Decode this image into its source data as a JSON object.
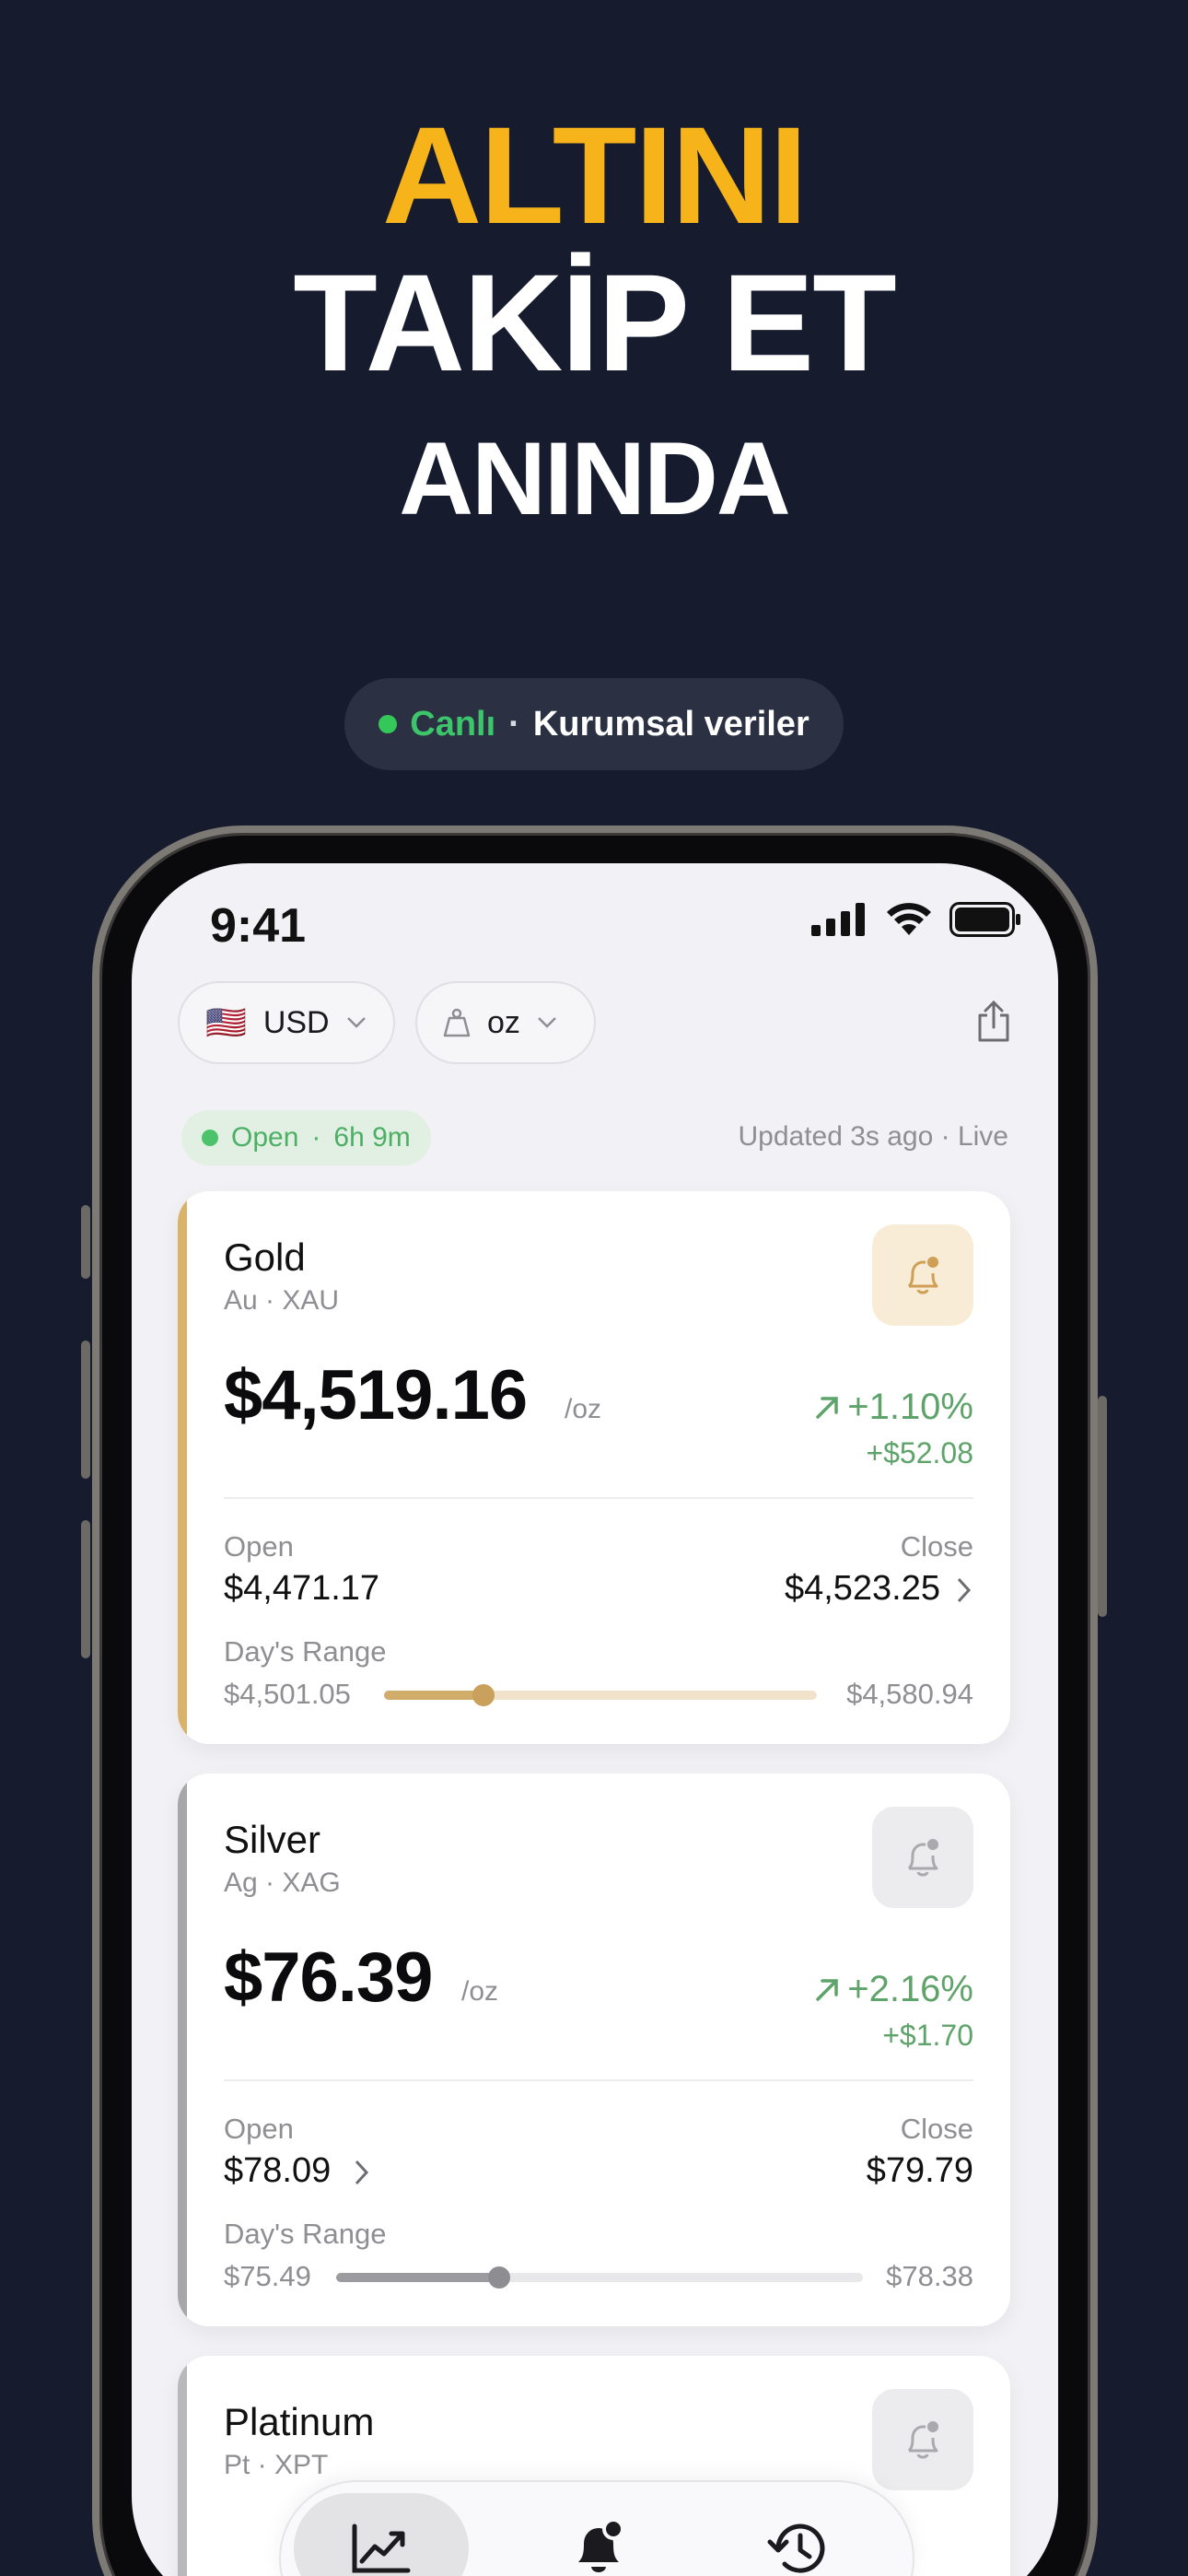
{
  "headline": {
    "line1": "ALTINI",
    "line2": "TAKİP ET",
    "line3": "ANINDA"
  },
  "badge": {
    "live_label": "Canlı",
    "separator": "·",
    "source_label": "Kurumsal veriler"
  },
  "status_bar": {
    "time": "9:41"
  },
  "toolbar": {
    "currency_flag": "🇺🇸",
    "currency_label": "USD",
    "unit_label": "oz",
    "share_icon": "share-icon"
  },
  "market": {
    "status_label": "Open",
    "status_sep": "·",
    "time_left": "6h 9m",
    "updated_text": "Updated 3s ago · Live"
  },
  "metals": [
    {
      "name": "Gold",
      "symbol": "Au · XAU",
      "price": "$4,519.16",
      "unit": "/oz",
      "change_pct": "+1.10%",
      "change_abs": "+$52.08",
      "open_label": "Open",
      "open_value": "$4,471.17",
      "close_label": "Close",
      "close_value": "$4,523.25",
      "range_label": "Day's Range",
      "range_low": "$4,501.05",
      "range_high": "$4,580.94",
      "range_position": 0.23,
      "accent_color": "#d9b36a"
    },
    {
      "name": "Silver",
      "symbol": "Ag · XAG",
      "price": "$76.39",
      "unit": "/oz",
      "change_pct": "+2.16%",
      "change_abs": "+$1.70",
      "open_label": "Open",
      "open_value": "$78.09",
      "close_label": "Close",
      "close_value": "$79.79",
      "range_label": "Day's Range",
      "range_low": "$75.49",
      "range_high": "$78.38",
      "range_position": 0.31,
      "accent_color": "#a7a7ab"
    },
    {
      "name": "Platinum",
      "symbol": "Pt · XPT",
      "accent_color": "#b9b9bd"
    }
  ],
  "tabs": [
    {
      "icon": "chart-icon",
      "active": true
    },
    {
      "icon": "bell-icon",
      "active": false
    },
    {
      "icon": "history-icon",
      "active": false
    }
  ],
  "colors": {
    "background": "#161b2e",
    "headline_accent": "#f6b41a",
    "positive": "#5ea36a",
    "live_green": "#3cc56b"
  }
}
